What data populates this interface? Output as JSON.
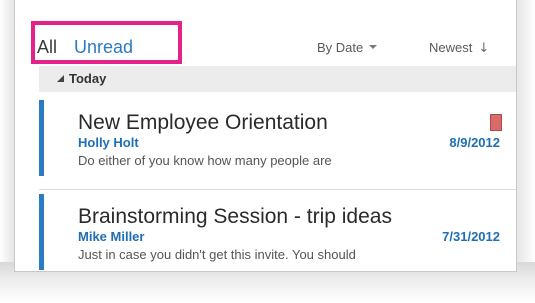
{
  "filters": {
    "all_label": "All",
    "unread_label": "Unread"
  },
  "sort": {
    "by_label": "By Date",
    "order_label": "Newest",
    "order_arrow": "↓"
  },
  "group": {
    "label": "Today"
  },
  "messages": [
    {
      "subject": "New Employee Orientation",
      "sender": "Holly Holt",
      "date": "8/9/2012",
      "preview": "Do either of you know how many people are",
      "flagged": true
    },
    {
      "subject": "Brainstorming Session - trip ideas",
      "sender": "Mike Miller",
      "date": "7/31/2012",
      "preview": "Just in case you didn't get this invite. You should",
      "flagged": false
    }
  ],
  "colors": {
    "accent": "#2b7bc4",
    "highlight_box": "#e3238a",
    "flag": "#d96b6b",
    "group_header_bg": "#ececec"
  }
}
